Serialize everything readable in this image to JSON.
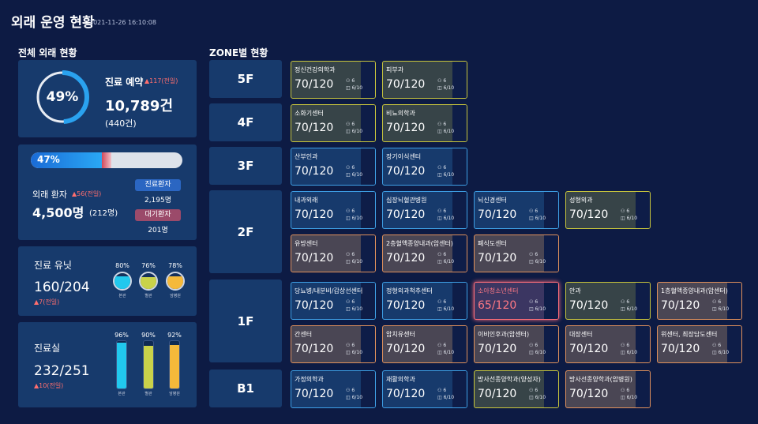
{
  "header": {
    "title": "외래 운영 현황",
    "timestamp": "2021-11-26 16:10:08"
  },
  "left_title": "전체 외래 현황",
  "zone_title": "ZONE별 현황",
  "reservation": {
    "pct": 49,
    "pct_label": "49%",
    "title": "진료 예약",
    "delta": "▲117(전일)",
    "count": "10,789건",
    "sub": "(440건)"
  },
  "outpatient": {
    "pct": 47,
    "pct_label": "47%",
    "title": "외래 환자",
    "delta": "▲56(전일)",
    "count": "4,500명",
    "sub": "(212명)",
    "treat_label": "진료환자",
    "treat_value": "2,195명",
    "wait_label": "대기환자",
    "wait_value": "201명"
  },
  "units": {
    "title": "진료 유닛",
    "value": "160/204",
    "delta": "▲7(전일)",
    "balls": [
      {
        "pct": 80,
        "pct_label": "80%",
        "label": "본관",
        "color": "#21c8ee"
      },
      {
        "pct": 76,
        "pct_label": "76%",
        "label": "별관",
        "color": "#c9d24a"
      },
      {
        "pct": 78,
        "pct_label": "78%",
        "label": "암병원",
        "color": "#f5b93a"
      }
    ]
  },
  "rooms": {
    "title": "진료실",
    "value": "232/251",
    "delta": "▲10(전일)",
    "bars": [
      {
        "pct": 96,
        "pct_label": "96%",
        "label": "본관",
        "color": "#21c8ee"
      },
      {
        "pct": 90,
        "pct_label": "90%",
        "label": "별관",
        "color": "#c9d24a"
      },
      {
        "pct": 92,
        "pct_label": "92%",
        "label": "암병원",
        "color": "#f5b93a"
      }
    ]
  },
  "floors": [
    "5F",
    "4F",
    "3F",
    "2F",
    "1F",
    "B1"
  ],
  "stat_a": "6",
  "stat_b": "6/10",
  "cards": [
    {
      "name": "정신건강의학과",
      "value": "70/120",
      "color": "y"
    },
    {
      "name": "피부과",
      "value": "70/120",
      "color": "y"
    },
    {
      "name": "소화기센터",
      "value": "70/120",
      "color": "y"
    },
    {
      "name": "비뇨의학과",
      "value": "70/120",
      "color": "y"
    },
    {
      "name": "산부인과",
      "value": "70/120",
      "color": "b"
    },
    {
      "name": "장기이식센터",
      "value": "70/120",
      "color": "b"
    },
    {
      "name": "내과외래",
      "value": "70/120",
      "color": "b"
    },
    {
      "name": "심장뇌혈관병원",
      "value": "70/120",
      "color": "b"
    },
    {
      "name": "뇌신경센터",
      "value": "70/120",
      "color": "b"
    },
    {
      "name": "성형외과",
      "value": "70/120",
      "color": "y"
    },
    {
      "name": "유방센터",
      "value": "70/120",
      "color": "o"
    },
    {
      "name": "2층혈액종양내과(암센터)",
      "value": "70/120",
      "color": "o"
    },
    {
      "name": "폐식도센터",
      "value": "70/120",
      "color": "o"
    },
    {
      "name": "당뇨병/내분비/갑상선센터",
      "value": "70/120",
      "color": "b"
    },
    {
      "name": "정형외과척추센터",
      "value": "70/120",
      "color": "b"
    },
    {
      "name": "소아청소년센터",
      "value": "65/120",
      "color": "r"
    },
    {
      "name": "안과",
      "value": "70/120",
      "color": "y"
    },
    {
      "name": "1층혈액종양내과(암센터)",
      "value": "70/120",
      "color": "o"
    },
    {
      "name": "간센터",
      "value": "70/120",
      "color": "o"
    },
    {
      "name": "암치유센터",
      "value": "70/120",
      "color": "o"
    },
    {
      "name": "이비인후과(암센터)",
      "value": "70/120",
      "color": "o"
    },
    {
      "name": "대장센터",
      "value": "70/120",
      "color": "o"
    },
    {
      "name": "위센터, 최장담도센터",
      "value": "70/120",
      "color": "o"
    },
    {
      "name": "가정의학과",
      "value": "70/120",
      "color": "b"
    },
    {
      "name": "재활의학과",
      "value": "70/120",
      "color": "b"
    },
    {
      "name": "방사선종양학과(양성자)",
      "value": "70/120",
      "color": "y"
    },
    {
      "name": "방사선종양학과(암병원)",
      "value": "70/120",
      "color": "o"
    }
  ]
}
